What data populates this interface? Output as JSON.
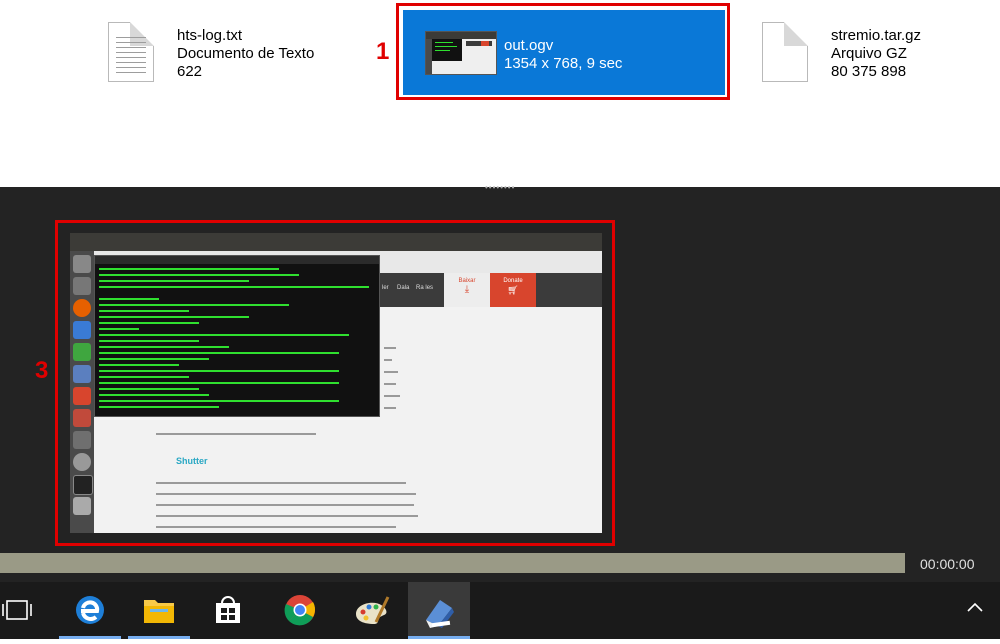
{
  "files": [
    {
      "name": "hts-log.txt",
      "type": "Documento de Texto",
      "size": "622"
    },
    {
      "name": "out.ogv",
      "details": "1354 x 768, 9 sec"
    },
    {
      "name": "stremio.tar.gz",
      "type": "Arquivo GZ",
      "size": "80 375 898"
    }
  ],
  "annotations": {
    "marker_1": "1",
    "marker_3": "3"
  },
  "player": {
    "time": "00:00:00",
    "frame": {
      "site_nav": [
        "ler",
        "Dala",
        "Ra les"
      ],
      "download_label": "Baixar",
      "donate_label": "Donate",
      "heading": "Shutter"
    }
  },
  "taskbar": {
    "items": [
      "task-view-icon",
      "edge-icon",
      "file-explorer-icon",
      "store-icon",
      "chrome-icon",
      "paint-icon",
      "pen-app-icon"
    ],
    "tray": "chevron-up-icon"
  },
  "colors": {
    "selection": "#0a78d7",
    "highlight": "#e00000",
    "terminal_text": "#2fe02f",
    "accent_underline": "#77aef0"
  }
}
